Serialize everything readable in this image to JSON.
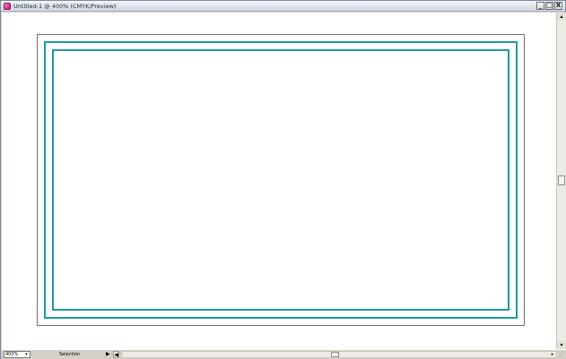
{
  "window": {
    "title": "Untitled-1 @ 400% (CMYK/Preview)",
    "buttons": {
      "minimize": "_",
      "maximize": "□",
      "close": "X"
    }
  },
  "canvas": {
    "frame_color": "#1b9aa6",
    "artboard_border_color": "#6e6e6e"
  },
  "status": {
    "zoom": "400%",
    "zoom_dropdown_icon": "▾",
    "tool_label": "Selection",
    "tool_dropdown_icon": "▶",
    "nav_prev_icon": "◀",
    "hscroll_arrow": "▸",
    "vscroll_up": "▴",
    "vscroll_down": "▾",
    "resize_grip": "⋰"
  },
  "icons": {
    "app": "illustrator-app-icon"
  }
}
